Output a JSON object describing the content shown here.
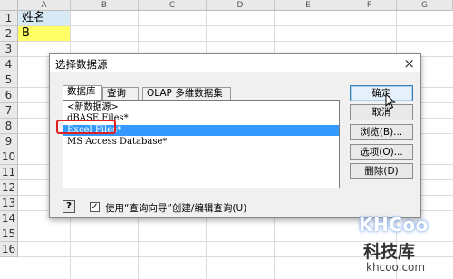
{
  "sheet": {
    "columns": [
      "A",
      "B",
      "C",
      "D",
      "E",
      "F",
      "G"
    ],
    "rows": [
      "1",
      "2",
      "3",
      "4",
      "5",
      "6",
      "7",
      "8",
      "9",
      "10",
      "11",
      "12",
      "13",
      "14",
      "15",
      "16"
    ],
    "cells": {
      "a1": "姓名",
      "a2": "B"
    }
  },
  "dialog": {
    "title": "选择数据源",
    "close_label": "×",
    "tabs": [
      {
        "label": "数据库"
      },
      {
        "label": "查询"
      },
      {
        "label": "OLAP 多维数据集"
      }
    ],
    "list_items": [
      {
        "label": "<新数据源>"
      },
      {
        "label": "dBASE Files*"
      },
      {
        "label": "Excel Files*"
      },
      {
        "label": "MS Access Database*"
      }
    ],
    "buttons": {
      "ok": "确定",
      "cancel": "取消",
      "browse": "浏览(B)...",
      "options": "选项(O)...",
      "delete": "删除(D)"
    },
    "help_label": "?",
    "wizard_checked": "✓",
    "wizard_label": "使用“查询向导”创建/编辑查询(U)"
  },
  "watermark": {
    "logo": "KHCoo",
    "name": "科技库",
    "url": "khcoo.com"
  },
  "colors": {
    "selection": "#3399ff",
    "name_cell": "#d9eaf7",
    "value_cell": "#ffff66",
    "highlight": "#e02020"
  }
}
